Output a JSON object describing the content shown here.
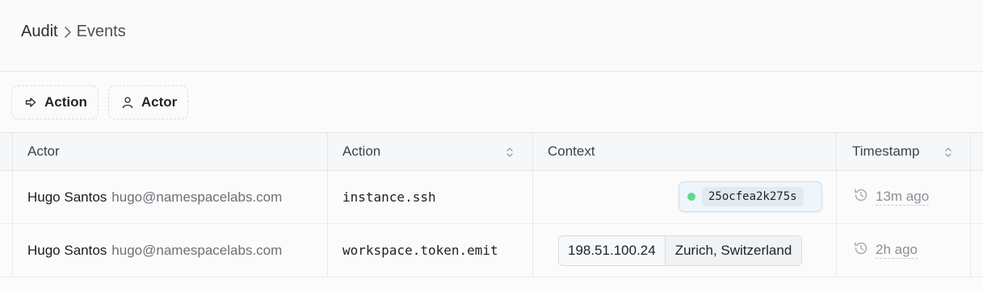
{
  "breadcrumb": {
    "root": "Audit",
    "current": "Events"
  },
  "filters": [
    {
      "label": "Action",
      "icon": "arrow-right-icon"
    },
    {
      "label": "Actor",
      "icon": "user-icon"
    }
  ],
  "table": {
    "columns": {
      "actor": "Actor",
      "action": "Action",
      "context": "Context",
      "timestamp": "Timestamp"
    },
    "rows": [
      {
        "actor_name": "Hugo Santos",
        "actor_email": "hugo@namespacelabs.com",
        "action": "instance.ssh",
        "context_commit": "25ocfea2k275s",
        "timestamp": "13m ago"
      },
      {
        "actor_name": "Hugo Santos",
        "actor_email": "hugo@namespacelabs.com",
        "action": "workspace.token.emit",
        "context_ip": "198.51.100.24",
        "context_location": "Zurich, Switzerland",
        "timestamp": "2h ago"
      }
    ]
  },
  "colors": {
    "status_dot": "#5fd98c",
    "border": "#e6e8eb",
    "muted": "#8a9096"
  }
}
